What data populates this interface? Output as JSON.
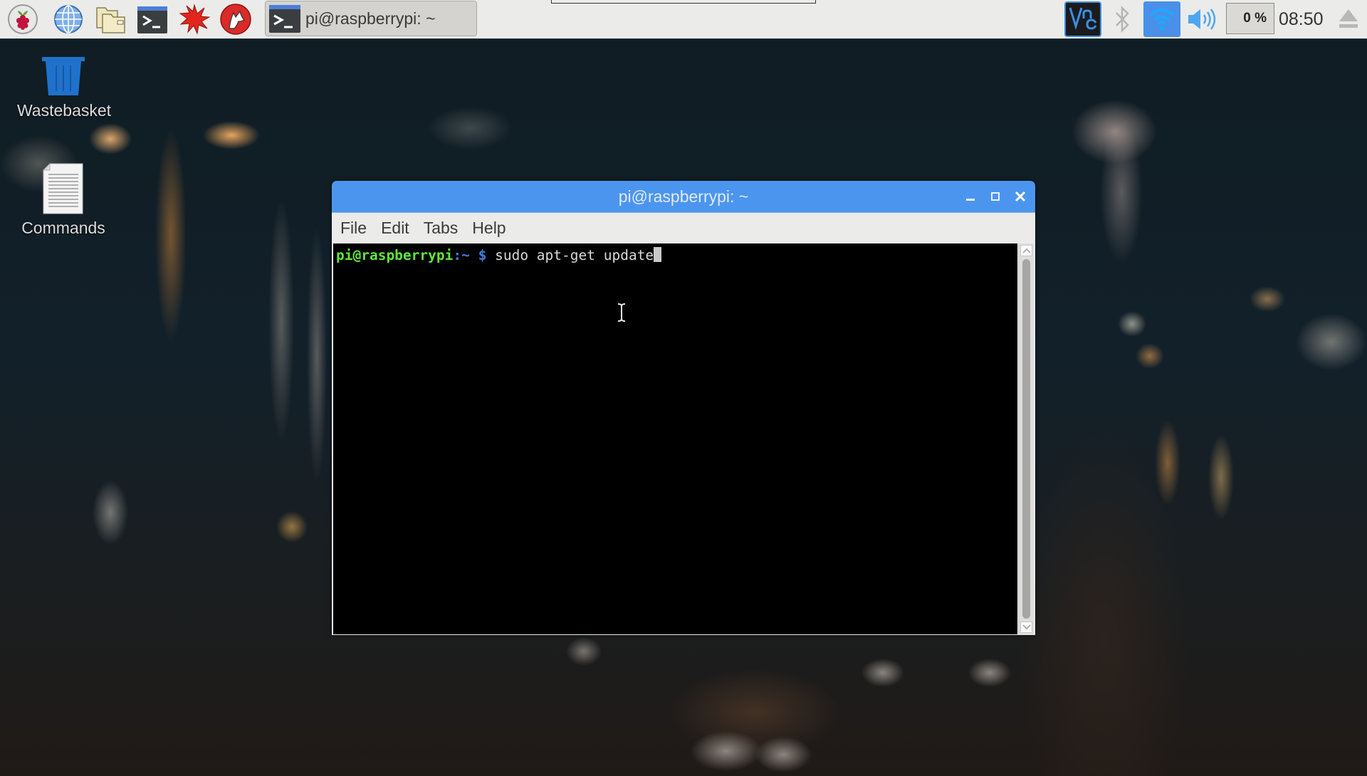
{
  "panel": {
    "launchers": [
      {
        "name": "raspberry-menu",
        "icon": "raspberry-icon"
      },
      {
        "name": "web-browser",
        "icon": "globe-icon"
      },
      {
        "name": "file-manager",
        "icon": "folder-icon"
      },
      {
        "name": "terminal",
        "icon": "terminal-icon"
      },
      {
        "name": "mathematica",
        "icon": "mathematica-icon"
      },
      {
        "name": "wolfram",
        "icon": "wolfram-icon"
      }
    ],
    "taskbar": [
      {
        "label": "pi@raspberrypi: ~",
        "icon": "terminal-icon",
        "active": true
      }
    ],
    "tray": {
      "vnc": "VNC",
      "bluetooth": "bluetooth-icon",
      "wifi": "wifi-icon",
      "volume": "volume-icon",
      "cpu_usage": "0 %",
      "clock": "08:50",
      "eject": "eject-icon"
    },
    "colors": {
      "wifi_bg": "#4a90e8",
      "vnc_bg": "#1b1b1b",
      "vnc_fg": "#3a8ee6"
    }
  },
  "desktop": {
    "icons": [
      {
        "label": "Wastebasket",
        "icon": "trash-icon"
      },
      {
        "label": "Commands",
        "icon": "document-icon"
      }
    ]
  },
  "window": {
    "title": "pi@raspberrypi: ~",
    "controls": {
      "minimize": "minimize",
      "maximize": "maximize",
      "close": "close"
    },
    "menu": [
      "File",
      "Edit",
      "Tabs",
      "Help"
    ],
    "terminal": {
      "prompt_user": "pi@raspberrypi",
      "prompt_sep": ":",
      "prompt_path": "~",
      "prompt_symbol": " $ ",
      "command": "sudo apt-get update"
    },
    "colors": {
      "titlebar": "#4c95ee",
      "prompt_user": "#5ee83a",
      "prompt_path": "#3f7fe0"
    }
  }
}
